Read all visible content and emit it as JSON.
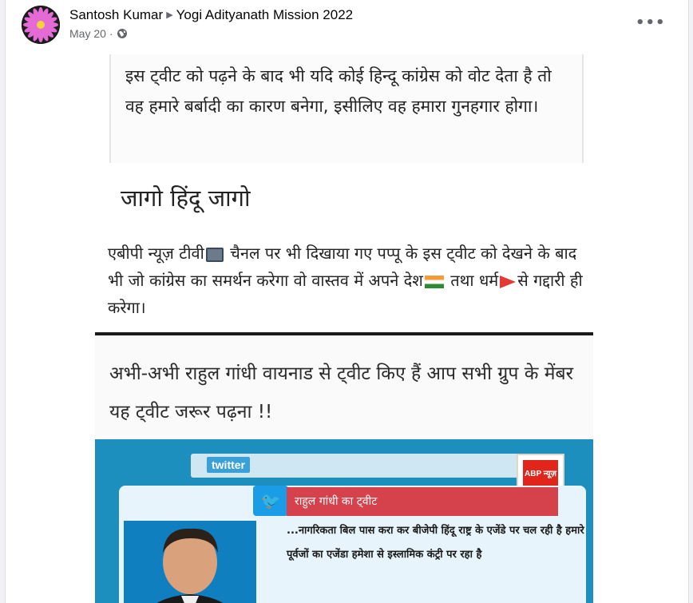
{
  "post": {
    "author": "Santosh Kumar",
    "group": "Yogi Adityanath Mission 2022",
    "date": "May 20",
    "privacy_icon": "globe-icon",
    "more_icon": "more-horizontal-icon"
  },
  "image": {
    "panel1_text": "इस ट्वीट को पढ़ने के बाद भी यदि कोई हिन्दू कांग्रेस को वोट देता है तो वह हमारे बर्बादी का कारण बनेगा, इसीलिए वह हमारा गुनहगार होगा।",
    "jago_heading": "जागो हिंदू जागो",
    "abp_line1": "एबीपी न्यूज़ टीवी",
    "abp_line2": " चैनल पर भी दिखाया गए पप्पू के इस ट्वीट को देखने के बाद भी जो कांग्रेस का समर्थन करेगा वो वास्तव में अपने देश",
    "abp_line3": " तथा धर्म",
    "abp_line4": "से गद्दारी ही करेगा।",
    "panel3_text": "अभी-अभी राहुल गांधी वायनाड से ट्वीट किए हैं आप सभी ग्रुप के मेंबर यह ट्वीट जरूर पढ़ना !!",
    "twitter_logo": "twitter",
    "tweet_header": "राहुल गांधी का ट्वीट",
    "tweet_body": "...नागरिकता बिल पास करा कर बीजेपी हिंदू राष्ट्र के एजेंडे पर चल रही है हमारे पूर्वजों का एजेंडा हमेशा से इस्लामिक कंट्री पर रहा है",
    "abp_logo_text": "ABP न्यूज़"
  }
}
